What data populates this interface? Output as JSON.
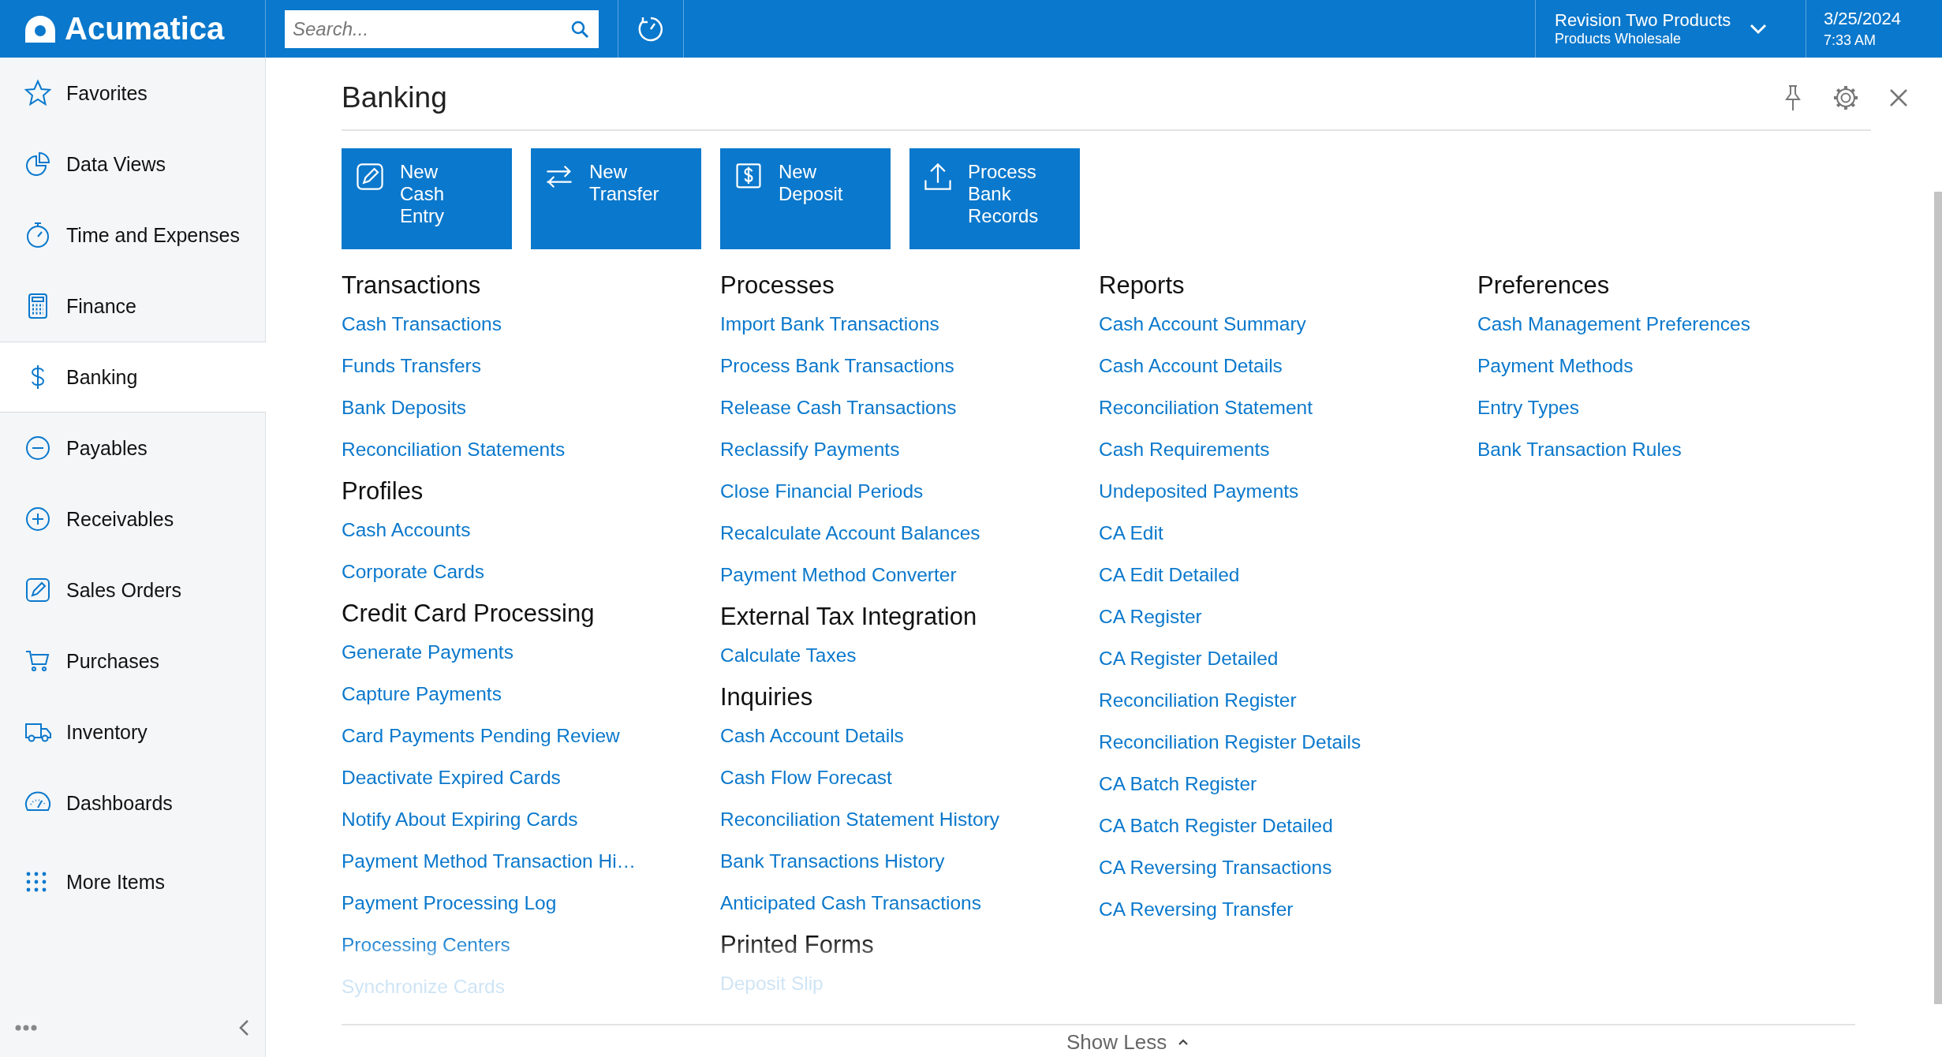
{
  "topbar": {
    "logo": "Acumatica",
    "search": {
      "placeholder": "Search..."
    },
    "company": {
      "name": "Revision Two Products",
      "branch": "Products Wholesale"
    },
    "date": "3/25/2024",
    "time": "7:33 AM"
  },
  "sidebar": {
    "items": [
      {
        "label": "Favorites",
        "selected": false
      },
      {
        "label": "Data Views",
        "selected": false
      },
      {
        "label": "Time and Expenses",
        "selected": false
      },
      {
        "label": "Finance",
        "selected": false
      },
      {
        "label": "Banking",
        "selected": true
      },
      {
        "label": "Payables",
        "selected": false
      },
      {
        "label": "Receivables",
        "selected": false
      },
      {
        "label": "Sales Orders",
        "selected": false
      },
      {
        "label": "Purchases",
        "selected": false
      },
      {
        "label": "Inventory",
        "selected": false
      },
      {
        "label": "Dashboards",
        "selected": false
      },
      {
        "label": "More Items",
        "selected": false
      }
    ]
  },
  "page": {
    "title": "Banking",
    "tiles": [
      {
        "label": "New Cash Entry"
      },
      {
        "label": "New Transfer"
      },
      {
        "label": "New Deposit"
      },
      {
        "label": "Process Bank Records"
      }
    ],
    "columns": [
      {
        "sections": [
          {
            "title": "Transactions",
            "links": [
              "Cash Transactions",
              "Funds Transfers",
              "Bank Deposits",
              "Reconciliation Statements"
            ]
          },
          {
            "title": "Profiles",
            "links": [
              "Cash Accounts",
              "Corporate Cards"
            ]
          },
          {
            "title": "Credit Card Processing",
            "links": [
              "Generate Payments",
              "Capture Payments",
              "Card Payments Pending Review",
              "Deactivate Expired Cards",
              "Notify About Expiring Cards",
              "Payment Method Transaction Hi…",
              "Payment Processing Log",
              "Processing Centers",
              "Synchronize Cards"
            ]
          }
        ]
      },
      {
        "sections": [
          {
            "title": "Processes",
            "links": [
              "Import Bank Transactions",
              "Process Bank Transactions",
              "Release Cash Transactions",
              "Reclassify Payments",
              "Close Financial Periods",
              "Recalculate Account Balances",
              "Payment Method Converter"
            ]
          },
          {
            "title": "External Tax Integration",
            "links": [
              "Calculate Taxes"
            ]
          },
          {
            "title": "Inquiries",
            "links": [
              "Cash Account Details",
              "Cash Flow Forecast",
              "Reconciliation Statement History",
              "Bank Transactions History",
              "Anticipated Cash Transactions"
            ]
          },
          {
            "title": "Printed Forms",
            "links": [
              "Deposit Slip"
            ]
          }
        ]
      },
      {
        "sections": [
          {
            "title": "Reports",
            "links": [
              "Cash Account Summary",
              "Cash Account Details",
              "Reconciliation Statement",
              "Cash Requirements",
              "Undeposited Payments",
              "CA Edit",
              "CA Edit Detailed",
              "CA Register",
              "CA Register Detailed",
              "Reconciliation Register",
              "Reconciliation Register Details",
              "CA Batch Register",
              "CA Batch Register Detailed",
              "CA Reversing Transactions",
              "CA Reversing Transfer"
            ]
          }
        ]
      },
      {
        "sections": [
          {
            "title": "Preferences",
            "links": [
              "Cash Management Preferences",
              "Payment Methods",
              "Entry Types",
              "Bank Transaction Rules"
            ]
          }
        ]
      }
    ],
    "show_less": "Show Less"
  }
}
